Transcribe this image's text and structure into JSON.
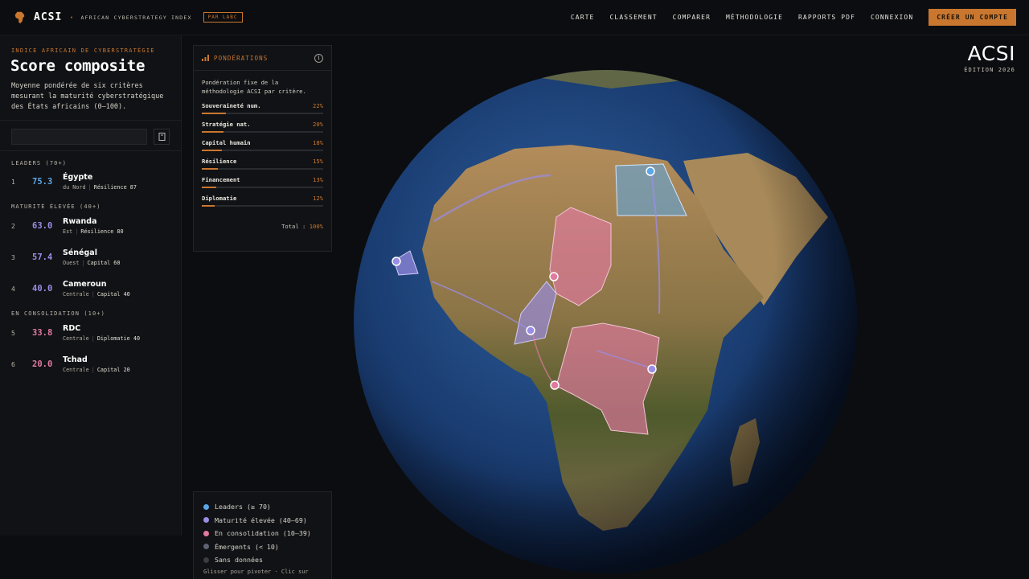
{
  "brand": {
    "name": "ACSI",
    "dot": "·",
    "subtitle": "AFRICAN CYBERSTRATEGY INDEX",
    "badge": "PAR LABC"
  },
  "nav": {
    "links": [
      "CARTE",
      "CLASSEMENT",
      "COMPARER",
      "MÉTHODOLOGIE",
      "RAPPORTS PDF",
      "CONNEXION"
    ],
    "cta": "CRÉER UN COMPTE"
  },
  "left": {
    "kicker": "INDICE AFRICAIN DE CYBERSTRATÉGIE",
    "title": "Score composite",
    "description": "Moyenne pondérée de six critères mesurant la maturité cyberstratégique des États africains (0–100).",
    "search_placeholder": "",
    "groups": [
      {
        "label": "LEADERS (70+)",
        "rows": [
          {
            "rank": "1",
            "score": "75.3",
            "color": "#5aa7e8",
            "name": "Égypte",
            "region": "du Nord",
            "metric": "Résilience 87"
          }
        ]
      },
      {
        "label": "MATURITÉ ÉLEVÉE (40+)",
        "rows": [
          {
            "rank": "2",
            "score": "63.0",
            "color": "#9a8de6",
            "name": "Rwanda",
            "region": "Est",
            "metric": "Résilience 80"
          },
          {
            "rank": "3",
            "score": "57.4",
            "color": "#9a8de6",
            "name": "Sénégal",
            "region": "Ouest",
            "metric": "Capital 60"
          },
          {
            "rank": "4",
            "score": "40.0",
            "color": "#9a8de6",
            "name": "Cameroun",
            "region": "Centrale",
            "metric": "Capital 40"
          }
        ]
      },
      {
        "label": "EN CONSOLIDATION (10+)",
        "rows": [
          {
            "rank": "5",
            "score": "33.8",
            "color": "#e27aa0",
            "name": "RDC",
            "region": "Centrale",
            "metric": "Diplomatie 40"
          },
          {
            "rank": "6",
            "score": "20.0",
            "color": "#e27aa0",
            "name": "Tchad",
            "region": "Centrale",
            "metric": "Capital 20"
          }
        ]
      }
    ]
  },
  "weights": {
    "title": "PONDÉRATIONS",
    "description": "Pondération fixe de la méthodologie ACSI par critère.",
    "items": [
      {
        "name": "Souveraineté num.",
        "pct": "22%",
        "value": 22
      },
      {
        "name": "Stratégie nat.",
        "pct": "20%",
        "value": 20
      },
      {
        "name": "Capital humain",
        "pct": "18%",
        "value": 18
      },
      {
        "name": "Résilience",
        "pct": "15%",
        "value": 15
      },
      {
        "name": "Financement",
        "pct": "13%",
        "value": 13
      },
      {
        "name": "Diplomatie",
        "pct": "12%",
        "value": 12
      }
    ],
    "total_label": "Total :",
    "total_value": "100%"
  },
  "legend": {
    "items": [
      {
        "label": "Leaders (≥ 70)",
        "color": "#5aa7e8"
      },
      {
        "label": "Maturité élevée (40–69)",
        "color": "#9a8de6"
      },
      {
        "label": "En consolidation (10–39)",
        "color": "#e27aa0"
      },
      {
        "label": "Émergents (< 10)",
        "color": "#5d6272"
      },
      {
        "label": "Sans données",
        "color": "#3a3c42"
      }
    ],
    "hint": "Glisser pour pivoter · Clic sur"
  },
  "edition": {
    "big": "ACSI",
    "small": "ÉDITION 2026"
  },
  "colors": {
    "accent": "#c9772f",
    "leader": "#5aa7e8",
    "high": "#9a8de6",
    "consolidation": "#e27aa0"
  }
}
